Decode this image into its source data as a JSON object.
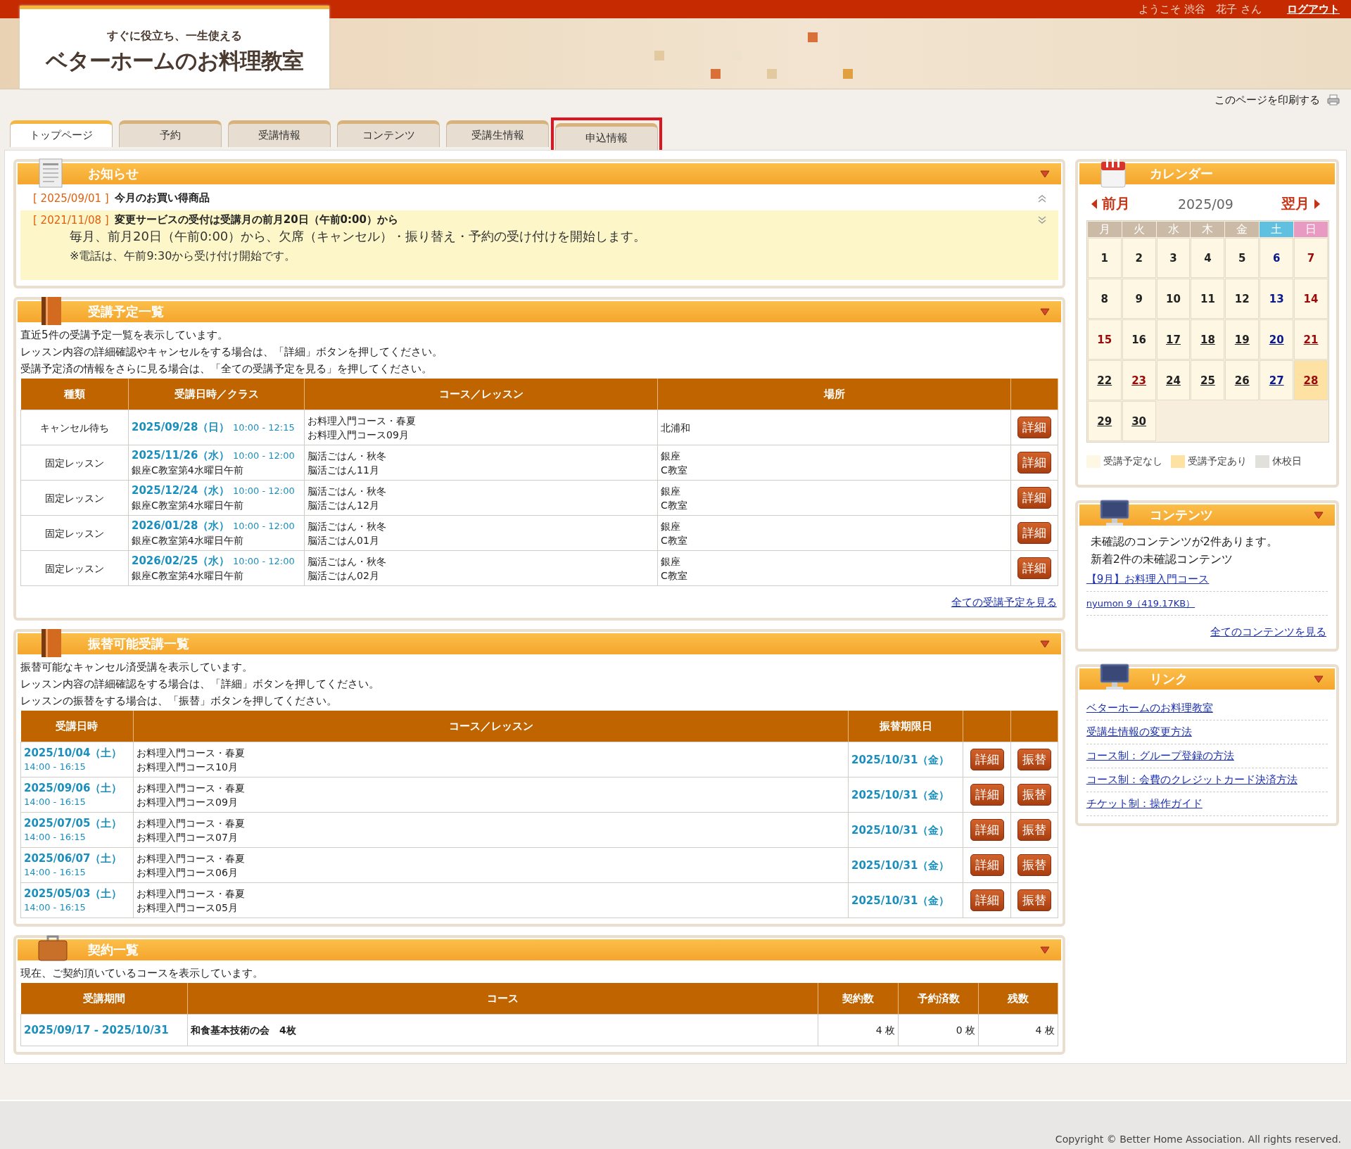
{
  "header": {
    "greeting": "ようこそ 渋谷　花子 さん",
    "logout": "ログアウト",
    "logo_tagline": "すぐに役立ち、一生使える",
    "logo_name": "ベターホームのお料理教室",
    "print_link": "このページを印刷する"
  },
  "tabs": [
    {
      "label": "トップページ",
      "selected": true,
      "highlighted": false
    },
    {
      "label": "予約",
      "selected": false,
      "highlighted": false
    },
    {
      "label": "受講情報",
      "selected": false,
      "highlighted": false
    },
    {
      "label": "コンテンツ",
      "selected": false,
      "highlighted": false
    },
    {
      "label": "受講生情報",
      "selected": false,
      "highlighted": false
    },
    {
      "label": "申込情報",
      "selected": false,
      "highlighted": true
    }
  ],
  "notices": {
    "title": "お知らせ",
    "items": [
      {
        "date": "[ 2025/09/01 ]",
        "title": "今月のお買い得商品",
        "expanded": false
      },
      {
        "date": "[ 2021/11/08 ]",
        "title": "変更サービスの受付は受講月の前月20日（午前0:00）から",
        "expanded": true,
        "body": [
          "毎月、前月20日（午前0:00）から、欠席（キャンセル）・振り替え・予約の受け付けを開始します。",
          "※電話は、午前9:30から受け付け開始です。"
        ]
      }
    ]
  },
  "schedule": {
    "title": "受講予定一覧",
    "intro": [
      "直近5件の受講予定一覧を表示しています。",
      "レッスン内容の詳細確認やキャンセルをする場合は、「詳細」ボタンを押してください。",
      "受講予定済の情報をさらに見る場合は、「全ての受講予定を見る」を押してください。"
    ],
    "columns": [
      "種類",
      "受講日時／クラス",
      "コース／レッスン",
      "場所"
    ],
    "rows": [
      {
        "type": "キャンセル待ち",
        "date": "2025/09/28（日）",
        "time": "10:00 - 12:15",
        "course": [
          "お料理入門コース・春夏",
          "お料理入門コース09月"
        ],
        "place": [
          "北浦和"
        ],
        "button": "詳細"
      },
      {
        "type": "固定レッスン",
        "date": "2025/11/26（水）",
        "time": "10:00 - 12:00",
        "class": "銀座C教室第4水曜日午前",
        "course": [
          "脳活ごはん・秋冬",
          "脳活ごはん11月"
        ],
        "place": [
          "銀座",
          "C教室"
        ],
        "button": "詳細"
      },
      {
        "type": "固定レッスン",
        "date": "2025/12/24（水）",
        "time": "10:00 - 12:00",
        "class": "銀座C教室第4水曜日午前",
        "course": [
          "脳活ごはん・秋冬",
          "脳活ごはん12月"
        ],
        "place": [
          "銀座",
          "C教室"
        ],
        "button": "詳細"
      },
      {
        "type": "固定レッスン",
        "date": "2026/01/28（水）",
        "time": "10:00 - 12:00",
        "class": "銀座C教室第4水曜日午前",
        "course": [
          "脳活ごはん・秋冬",
          "脳活ごはん01月"
        ],
        "place": [
          "銀座",
          "C教室"
        ],
        "button": "詳細"
      },
      {
        "type": "固定レッスン",
        "date": "2026/02/25（水）",
        "time": "10:00 - 12:00",
        "class": "銀座C教室第4水曜日午前",
        "course": [
          "脳活ごはん・秋冬",
          "脳活ごはん02月"
        ],
        "place": [
          "銀座",
          "C教室"
        ],
        "button": "詳細"
      }
    ],
    "more_link": "全ての受講予定を見る"
  },
  "transfers": {
    "title": "振替可能受講一覧",
    "intro": [
      "振替可能なキャンセル済受講を表示しています。",
      "レッスン内容の詳細確認をする場合は、「詳細」ボタンを押してください。",
      "レッスンの振替をする場合は、「振替」ボタンを押してください。"
    ],
    "columns": [
      "受講日時",
      "コース／レッスン",
      "振替期限日"
    ],
    "rows": [
      {
        "date": "2025/10/04（土）",
        "time": "14:00 - 16:15",
        "course": [
          "お料理入門コース・春夏",
          "お料理入門コース10月"
        ],
        "deadline": "2025/10/31（金）",
        "buttons": [
          "詳細",
          "振替"
        ]
      },
      {
        "date": "2025/09/06（土）",
        "time": "14:00 - 16:15",
        "course": [
          "お料理入門コース・春夏",
          "お料理入門コース09月"
        ],
        "deadline": "2025/10/31（金）",
        "buttons": [
          "詳細",
          "振替"
        ]
      },
      {
        "date": "2025/07/05（土）",
        "time": "14:00 - 16:15",
        "course": [
          "お料理入門コース・春夏",
          "お料理入門コース07月"
        ],
        "deadline": "2025/10/31（金）",
        "buttons": [
          "詳細",
          "振替"
        ]
      },
      {
        "date": "2025/06/07（土）",
        "time": "14:00 - 16:15",
        "course": [
          "お料理入門コース・春夏",
          "お料理入門コース06月"
        ],
        "deadline": "2025/10/31（金）",
        "buttons": [
          "詳細",
          "振替"
        ]
      },
      {
        "date": "2025/05/03（土）",
        "time": "14:00 - 16:15",
        "course": [
          "お料理入門コース・春夏",
          "お料理入門コース05月"
        ],
        "deadline": "2025/10/31（金）",
        "buttons": [
          "詳細",
          "振替"
        ]
      }
    ]
  },
  "contracts": {
    "title": "契約一覧",
    "intro": "現在、ご契約頂いているコースを表示しています。",
    "columns": [
      "受講期間",
      "コース",
      "契約数",
      "予約済数",
      "残数"
    ],
    "rows": [
      {
        "period": "2025/09/17 - 2025/10/31",
        "course": "和食基本技術の会　4枚",
        "contracted": "4 枚",
        "reserved": "0 枚",
        "remaining": "4 枚"
      }
    ]
  },
  "calendar": {
    "title": "カレンダー",
    "prev": "前月",
    "month": "2025/09",
    "next": "翌月",
    "weekdays": [
      {
        "label": "月",
        "kind": "weekday"
      },
      {
        "label": "火",
        "kind": "weekday"
      },
      {
        "label": "水",
        "kind": "weekday"
      },
      {
        "label": "木",
        "kind": "weekday"
      },
      {
        "label": "金",
        "kind": "weekday"
      },
      {
        "label": "土",
        "kind": "saturday"
      },
      {
        "label": "日",
        "kind": "sunday"
      }
    ],
    "days": [
      {
        "day": "1",
        "kind": "weekday",
        "link": false,
        "has_lesson": false
      },
      {
        "day": "2",
        "kind": "weekday",
        "link": false,
        "has_lesson": false
      },
      {
        "day": "3",
        "kind": "weekday",
        "link": false,
        "has_lesson": false
      },
      {
        "day": "4",
        "kind": "weekday",
        "link": false,
        "has_lesson": false
      },
      {
        "day": "5",
        "kind": "weekday",
        "link": false,
        "has_lesson": false
      },
      {
        "day": "6",
        "kind": "saturday",
        "link": false,
        "has_lesson": false
      },
      {
        "day": "7",
        "kind": "holiday",
        "link": false,
        "has_lesson": false
      },
      {
        "day": "8",
        "kind": "weekday",
        "link": false,
        "has_lesson": false
      },
      {
        "day": "9",
        "kind": "weekday",
        "link": false,
        "has_lesson": false
      },
      {
        "day": "10",
        "kind": "weekday",
        "link": false,
        "has_lesson": false
      },
      {
        "day": "11",
        "kind": "weekday",
        "link": false,
        "has_lesson": false
      },
      {
        "day": "12",
        "kind": "weekday",
        "link": false,
        "has_lesson": false
      },
      {
        "day": "13",
        "kind": "saturday",
        "link": false,
        "has_lesson": false
      },
      {
        "day": "14",
        "kind": "holiday",
        "link": false,
        "has_lesson": false
      },
      {
        "day": "15",
        "kind": "holiday",
        "link": false,
        "has_lesson": false
      },
      {
        "day": "16",
        "kind": "weekday",
        "link": false,
        "has_lesson": false
      },
      {
        "day": "17",
        "kind": "weekday",
        "link": true,
        "has_lesson": false
      },
      {
        "day": "18",
        "kind": "weekday",
        "link": true,
        "has_lesson": false
      },
      {
        "day": "19",
        "kind": "weekday",
        "link": true,
        "has_lesson": false
      },
      {
        "day": "20",
        "kind": "saturday",
        "link": true,
        "has_lesson": false
      },
      {
        "day": "21",
        "kind": "holiday",
        "link": true,
        "has_lesson": false
      },
      {
        "day": "22",
        "kind": "weekday",
        "link": true,
        "has_lesson": false
      },
      {
        "day": "23",
        "kind": "holiday",
        "link": true,
        "has_lesson": false
      },
      {
        "day": "24",
        "kind": "weekday",
        "link": true,
        "has_lesson": false
      },
      {
        "day": "25",
        "kind": "weekday",
        "link": true,
        "has_lesson": false
      },
      {
        "day": "26",
        "kind": "weekday",
        "link": true,
        "has_lesson": false
      },
      {
        "day": "27",
        "kind": "saturday",
        "link": true,
        "has_lesson": false
      },
      {
        "day": "28",
        "kind": "holiday",
        "link": true,
        "has_lesson": true
      },
      {
        "day": "29",
        "kind": "weekday",
        "link": true,
        "has_lesson": false
      },
      {
        "day": "30",
        "kind": "weekday",
        "link": true,
        "has_lesson": false
      }
    ],
    "legend": [
      {
        "label": "受講予定なし",
        "color": "#fdf7e4"
      },
      {
        "label": "受講予定あり",
        "color": "#fde2a4"
      },
      {
        "label": "休校日",
        "color": "#e2e0db"
      }
    ]
  },
  "contents": {
    "title": "コンテンツ",
    "lines": [
      "未確認のコンテンツが2件あります。",
      "新着2件の未確認コンテンツ"
    ],
    "links": [
      {
        "label": "【9月】お料理入門コース",
        "kind": "title"
      },
      {
        "label": "nyumon 9（419.17KB）",
        "kind": "file"
      }
    ],
    "more_link": "全てのコンテンツを見る"
  },
  "links": {
    "title": "リンク",
    "items": [
      "ベターホームのお料理教室",
      "受講生情報の変更方法",
      "コース制：グループ登録の方法",
      "コース制：会費のクレジットカード決済方法",
      "チケット制：操作ガイド"
    ]
  },
  "footer": {
    "copyright": "Copyright © Better Home Association. All rights reserved."
  }
}
